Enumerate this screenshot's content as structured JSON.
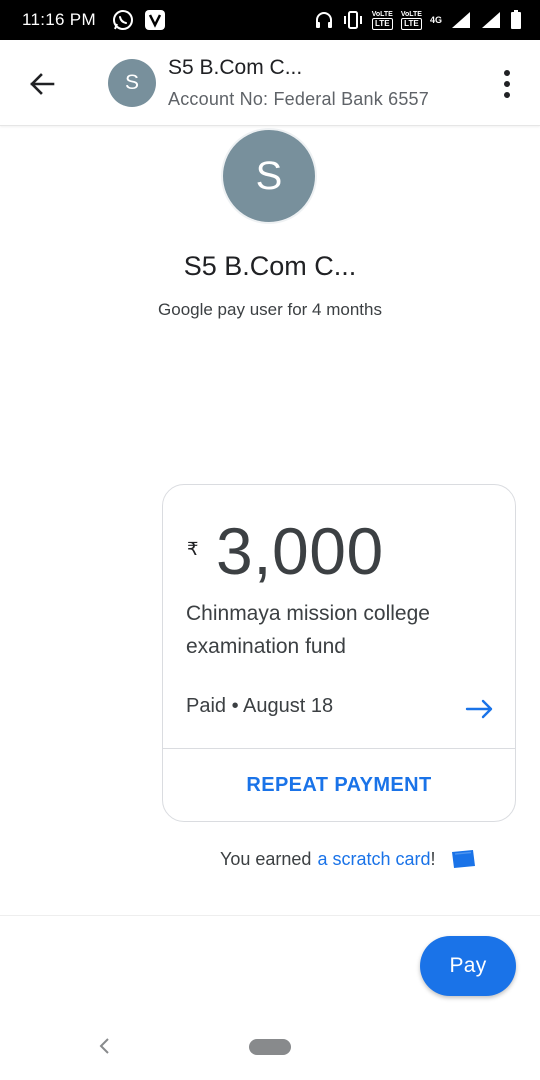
{
  "status_bar": {
    "time": "11:16 PM",
    "icons": [
      "whatsapp-icon",
      "v-app-icon",
      "headphones-icon",
      "vibrate-icon",
      "volte-1-icon",
      "volte-2-icon",
      "signal-4g-icon",
      "signal-icon",
      "battery-icon"
    ],
    "volte1_top": "VoLTE",
    "volte1_badge": "LTE",
    "volte2_top": "VoLTE",
    "volte2_badge": "LTE",
    "network": "4G"
  },
  "header": {
    "back_icon": "arrow-back-icon",
    "avatar_letter": "S",
    "name": "S5 B.Com C...",
    "account": "Account No: Federal Bank 6557",
    "more_icon": "more-vert-icon"
  },
  "profile": {
    "avatar_letter": "S",
    "name": "S5 B.Com C...",
    "subtitle": "Google pay user for 4 months",
    "avatar_color": "#78909c"
  },
  "payment": {
    "currency_symbol": "₹",
    "amount": "3,000",
    "note": "Chinmaya mission college examination fund",
    "status": "Paid • August 18",
    "details_icon": "arrow-right-icon",
    "repeat_label": "REPEAT PAYMENT"
  },
  "scratch": {
    "prefix": "You earned",
    "link": "a scratch card",
    "suffix": "!",
    "icon": "scratch-card-icon"
  },
  "pay_button": {
    "label": "Pay"
  },
  "nav": {
    "back_icon": "nav-back-icon",
    "home_icon": "nav-home-pill"
  },
  "colors": {
    "accent": "#1a73e8",
    "avatar": "#78909c",
    "status_bar": "#000000"
  }
}
